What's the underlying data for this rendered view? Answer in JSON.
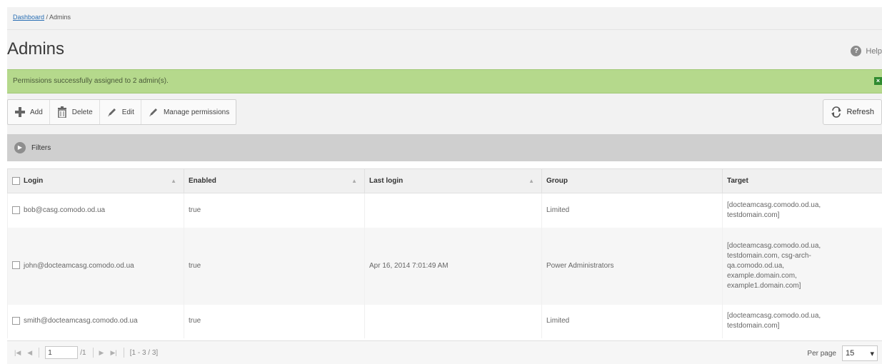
{
  "breadcrumb": {
    "link": "Dashboard",
    "separator": " / ",
    "current": "Admins"
  },
  "page": {
    "title": "Admins",
    "help_label": "Help"
  },
  "alert": {
    "message": "Permissions successfully assigned to 2 admin(s).",
    "color": "#b5d98c"
  },
  "toolbar": {
    "add": "Add",
    "delete": "Delete",
    "edit": "Edit",
    "manage": "Manage permissions",
    "refresh": "Refresh"
  },
  "filters": {
    "label": "Filters"
  },
  "table": {
    "columns": [
      "Login",
      "Enabled",
      "Last login",
      "Group",
      "Target"
    ],
    "rows": [
      {
        "login": "bob@casg.comodo.od.ua",
        "enabled": "true",
        "last_login": "",
        "group": "Limited",
        "target_lines": [
          "[docteamcasg.comodo.od.ua,",
          "testdomain.com]"
        ]
      },
      {
        "login": "john@docteamcasg.comodo.od.ua",
        "enabled": "true",
        "last_login": "Apr 16, 2014 7:01:49 AM",
        "group": "Power Administrators",
        "target_lines": [
          "[docteamcasg.comodo.od.ua,",
          "testdomain.com, csg-arch-",
          "qa.comodo.od.ua,",
          "example.domain.com,",
          "example1.domain.com]"
        ]
      },
      {
        "login": "smith@docteamcasg.comodo.od.ua",
        "enabled": "true",
        "last_login": "",
        "group": "Limited",
        "target_lines": [
          "[docteamcasg.comodo.od.ua,",
          "testdomain.com]"
        ]
      }
    ]
  },
  "pager": {
    "page": "1",
    "total_pages": "/1",
    "range": "[1 - 3 / 3]",
    "per_page_label": "Per page",
    "per_page": "15"
  }
}
